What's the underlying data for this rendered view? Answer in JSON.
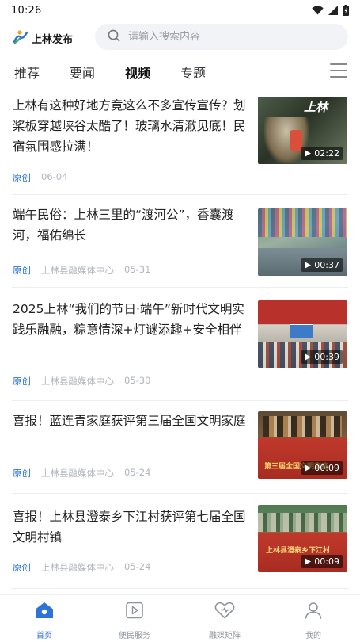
{
  "status_bar": {
    "time": "10:26"
  },
  "header": {
    "logo_text": "上林发布",
    "search": {
      "placeholder": "请输入搜索内容"
    }
  },
  "tabs": [
    {
      "label": "推荐",
      "active": false
    },
    {
      "label": "要闻",
      "active": false
    },
    {
      "label": "视频",
      "active": true
    },
    {
      "label": "专题",
      "active": false
    }
  ],
  "news": [
    {
      "title": "上林有这种好地方竟这么不多宣传宣传？划桨板穿越峡谷太酷了！玻璃水清澈见底！民宿氛围感拉满！",
      "origin": "原创",
      "source": "",
      "date": "06-04",
      "duration": "02:22",
      "thumb_text": "上林",
      "thumb_colors": [
        "#3c4a3c",
        "#5d6d57",
        "#2c3528"
      ]
    },
    {
      "title": "端午民俗：上林三里的“渡河公”，香囊渡河，福佑绵长",
      "origin": "原创",
      "source": "上林县融媒体中心",
      "date": "05-31",
      "duration": "00:37",
      "thumb_text": "",
      "thumb_colors": [
        "#5f7f6a",
        "#8a9a74",
        "#4a6a6e"
      ]
    },
    {
      "title": "2025上林“我们的节日·端午”新时代文明实践乐融融，粽意情深+灯谜添趣+安全相伴",
      "origin": "原创",
      "source": "上林县融媒体中心",
      "date": "05-30",
      "duration": "00:39",
      "thumb_text": "",
      "thumb_colors": [
        "#b6322c",
        "#d45a3a",
        "#3f5e8c"
      ]
    },
    {
      "title": "喜报！蓝连青家庭获评第三届全国文明家庭",
      "origin": "原创",
      "source": "上林县融媒体中心",
      "date": "05-24",
      "duration": "00:09",
      "thumb_text": "第三届全国文明家庭",
      "thumb_colors": [
        "#6a4a2e",
        "#c0392b",
        "#b22a22"
      ]
    },
    {
      "title": "喜报！上林县澄泰乡下江村获评第七届全国文明村镇",
      "origin": "原创",
      "source": "上林县融媒体中心",
      "date": "05-24",
      "duration": "00:09",
      "thumb_text": "上林县澄泰乡下江村",
      "thumb_colors": [
        "#4f7a52",
        "#c0392b",
        "#b22a22"
      ]
    }
  ],
  "bottom_nav": [
    {
      "label": "首页",
      "icon": "home-icon",
      "active": true
    },
    {
      "label": "便民服务",
      "icon": "play-square-icon",
      "active": false
    },
    {
      "label": "融媒矩阵",
      "icon": "heart-icon",
      "active": false
    },
    {
      "label": "我的",
      "icon": "user-icon",
      "active": false
    }
  ],
  "colors": {
    "accent": "#2e73d7",
    "meta": "#b2b6bc"
  }
}
